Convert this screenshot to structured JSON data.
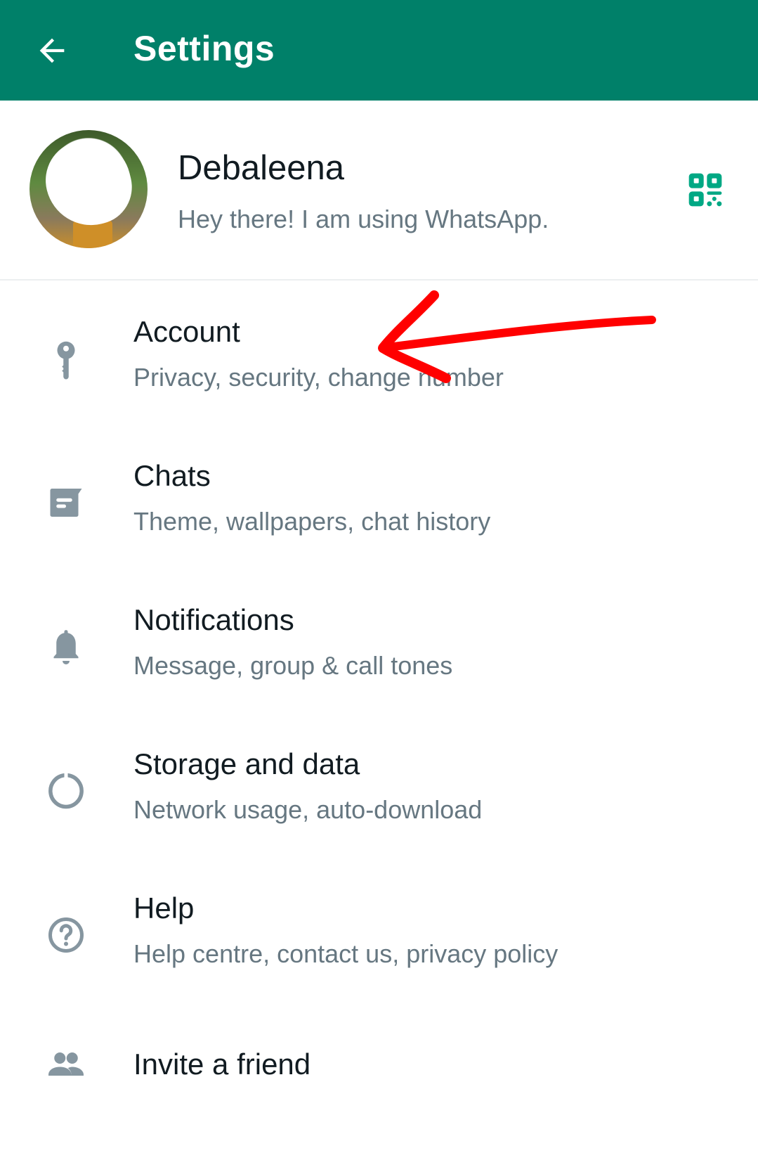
{
  "appbar": {
    "title": "Settings",
    "back_icon": "arrow-left-icon",
    "background": "#008069"
  },
  "profile": {
    "name": "Debaleena",
    "status": "Hey there! I am using WhatsApp.",
    "qr_icon": "qr-code-icon",
    "accent": "#00a884"
  },
  "items": [
    {
      "icon": "key-icon",
      "label": "Account",
      "sub": "Privacy, security, change number"
    },
    {
      "icon": "chat-icon",
      "label": "Chats",
      "sub": "Theme, wallpapers, chat history"
    },
    {
      "icon": "bell-icon",
      "label": "Notifications",
      "sub": "Message, group & call tones"
    },
    {
      "icon": "storage-ring-icon",
      "label": "Storage and data",
      "sub": "Network usage, auto-download"
    },
    {
      "icon": "help-icon",
      "label": "Help",
      "sub": "Help centre, contact us, privacy policy"
    },
    {
      "icon": "people-icon",
      "label": "Invite a friend"
    }
  ],
  "annotation": {
    "type": "red-arrow",
    "points_to": "Account",
    "color": "#ff0000"
  },
  "colors": {
    "icon_gray": "#8696a0",
    "primary_text": "#111b21",
    "secondary_text": "#667781"
  }
}
